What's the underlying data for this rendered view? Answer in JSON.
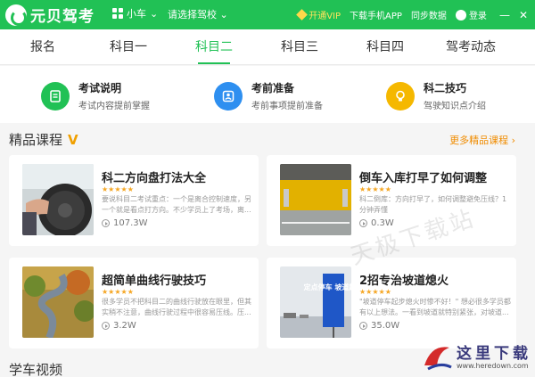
{
  "app": {
    "name": "元贝驾考"
  },
  "topbar": {
    "car_type": "小车",
    "school": "请选择驾校",
    "vip": "开通VIP",
    "download": "下载手机APP",
    "sync": "同步数据",
    "login": "登录",
    "minimize": "—",
    "close": "✕"
  },
  "nav": {
    "tabs": [
      "报名",
      "科目一",
      "科目二",
      "科目三",
      "科目四",
      "驾考动态"
    ],
    "active_index": 2
  },
  "features": [
    {
      "title": "考试说明",
      "subtitle": "考试内容提前掌握",
      "icon": "document-icon",
      "color": "#21c155"
    },
    {
      "title": "考前准备",
      "subtitle": "考前事项提前准备",
      "icon": "user-check-icon",
      "color": "#2e8ff0"
    },
    {
      "title": "科二技巧",
      "subtitle": "驾驶知识点介绍",
      "icon": "lightbulb-icon",
      "color": "#f5b800"
    }
  ],
  "section": {
    "title": "精品课程",
    "badge": "V",
    "more": "更多精品课程 ›"
  },
  "courses": [
    {
      "title": "科二方向盘打法大全",
      "stars": "★★★★★",
      "desc": "要说科目二考试重点：一个是离合控制速度，另一个就是看点打方向。不少学员上了考场，离...",
      "views": "107.3W"
    },
    {
      "title": "倒车入库打早了如何调整",
      "stars": "★★★★★",
      "desc": "科二倒库：方向打早了，如何调整避免压线？1分钟弄懂",
      "views": "0.3W"
    },
    {
      "title": "超简单曲线行驶技巧",
      "stars": "★★★★★",
      "desc": "很多学员不把科目二的曲线行驶放在眼里，但其实稍不注意，曲线行驶过程中很容易压线。压...",
      "views": "3.2W"
    },
    {
      "title": "2招专治坡道熄火",
      "stars": "★★★★★",
      "desc": "\"坡道停车起步熄火时惨不好！\" 想必很多学员都有以上想法。一看到坡道就特别紧张，对坡道...",
      "views": "35.0W"
    }
  ],
  "bottom_section": {
    "title": "学车视频"
  },
  "sign_text": "定点停车 坡道起步",
  "watermark": {
    "center": "天极下载站",
    "corner_text": "这里下载",
    "corner_url": "www.heredown.com"
  }
}
